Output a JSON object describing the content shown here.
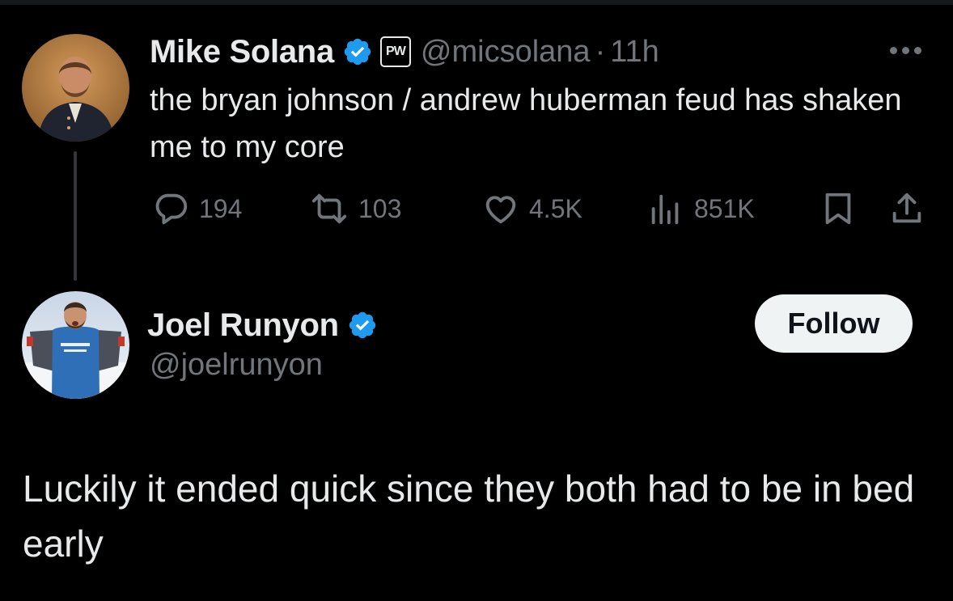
{
  "original_tweet": {
    "author_name": "Mike Solana",
    "affiliation_badge": "PW",
    "handle": "@micsolana",
    "separator": "·",
    "time": "11h",
    "text": "the bryan johnson / andrew huberman feud has shaken me to my core",
    "verified": true,
    "actions": {
      "replies": "194",
      "retweets": "103",
      "likes": "4.5K",
      "views": "851K"
    }
  },
  "reply": {
    "author_name": "Joel Runyon",
    "handle": "@joelrunyon",
    "verified": true,
    "follow_label": "Follow",
    "text": "Luckily it ended quick since they both had to be in bed early"
  },
  "icons": [
    "more-icon",
    "verified-icon",
    "reply-icon",
    "retweet-icon",
    "like-icon",
    "views-icon",
    "bookmark-icon",
    "share-icon"
  ],
  "colors": {
    "background": "#000000",
    "text_primary": "#e7e9ea",
    "text_secondary": "#71767b",
    "verified_blue": "#1d9bf0",
    "thread_line": "#333639",
    "follow_button_bg": "#eff3f4"
  }
}
